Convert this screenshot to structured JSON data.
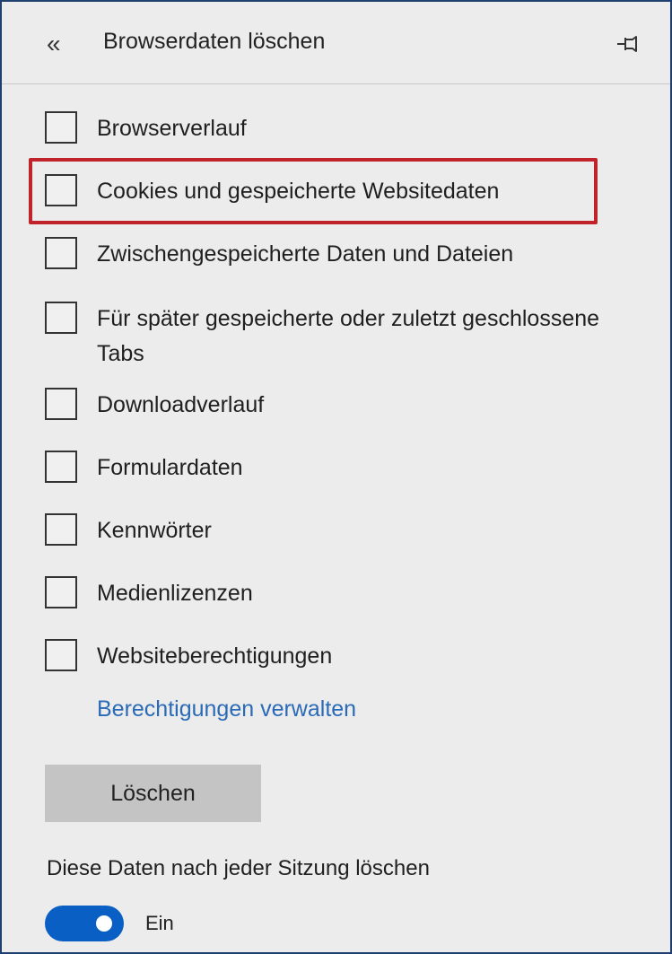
{
  "header": {
    "back_icon": "double-chevron-left",
    "back_glyph": "«",
    "title": "Browserdaten löschen",
    "pin_icon": "pin-icon"
  },
  "options": [
    {
      "label": "Browserverlauf",
      "checked": false
    },
    {
      "label": "Cookies und gespeicherte Websitedaten",
      "checked": false,
      "highlighted": true
    },
    {
      "label": "Zwischengespeicherte Daten und Dateien",
      "checked": false
    },
    {
      "label": "Für später gespeicherte oder zuletzt geschlossene Tabs",
      "checked": false
    },
    {
      "label": "Downloadverlauf",
      "checked": false
    },
    {
      "label": "Formulardaten",
      "checked": false
    },
    {
      "label": "Kennwörter",
      "checked": false
    },
    {
      "label": "Medienlizenzen",
      "checked": false
    },
    {
      "label": "Websiteberechtigungen",
      "checked": false
    }
  ],
  "manage_link": "Berechtigungen verwalten",
  "delete_button": "Löschen",
  "session": {
    "label": "Diese Daten nach jeder Sitzung löschen",
    "toggle_on": true,
    "toggle_text": "Ein"
  },
  "colors": {
    "accent": "#0a5fc4",
    "link": "#2a6ab6",
    "highlight": "#c0232a",
    "panel_bg": "#ececec"
  }
}
